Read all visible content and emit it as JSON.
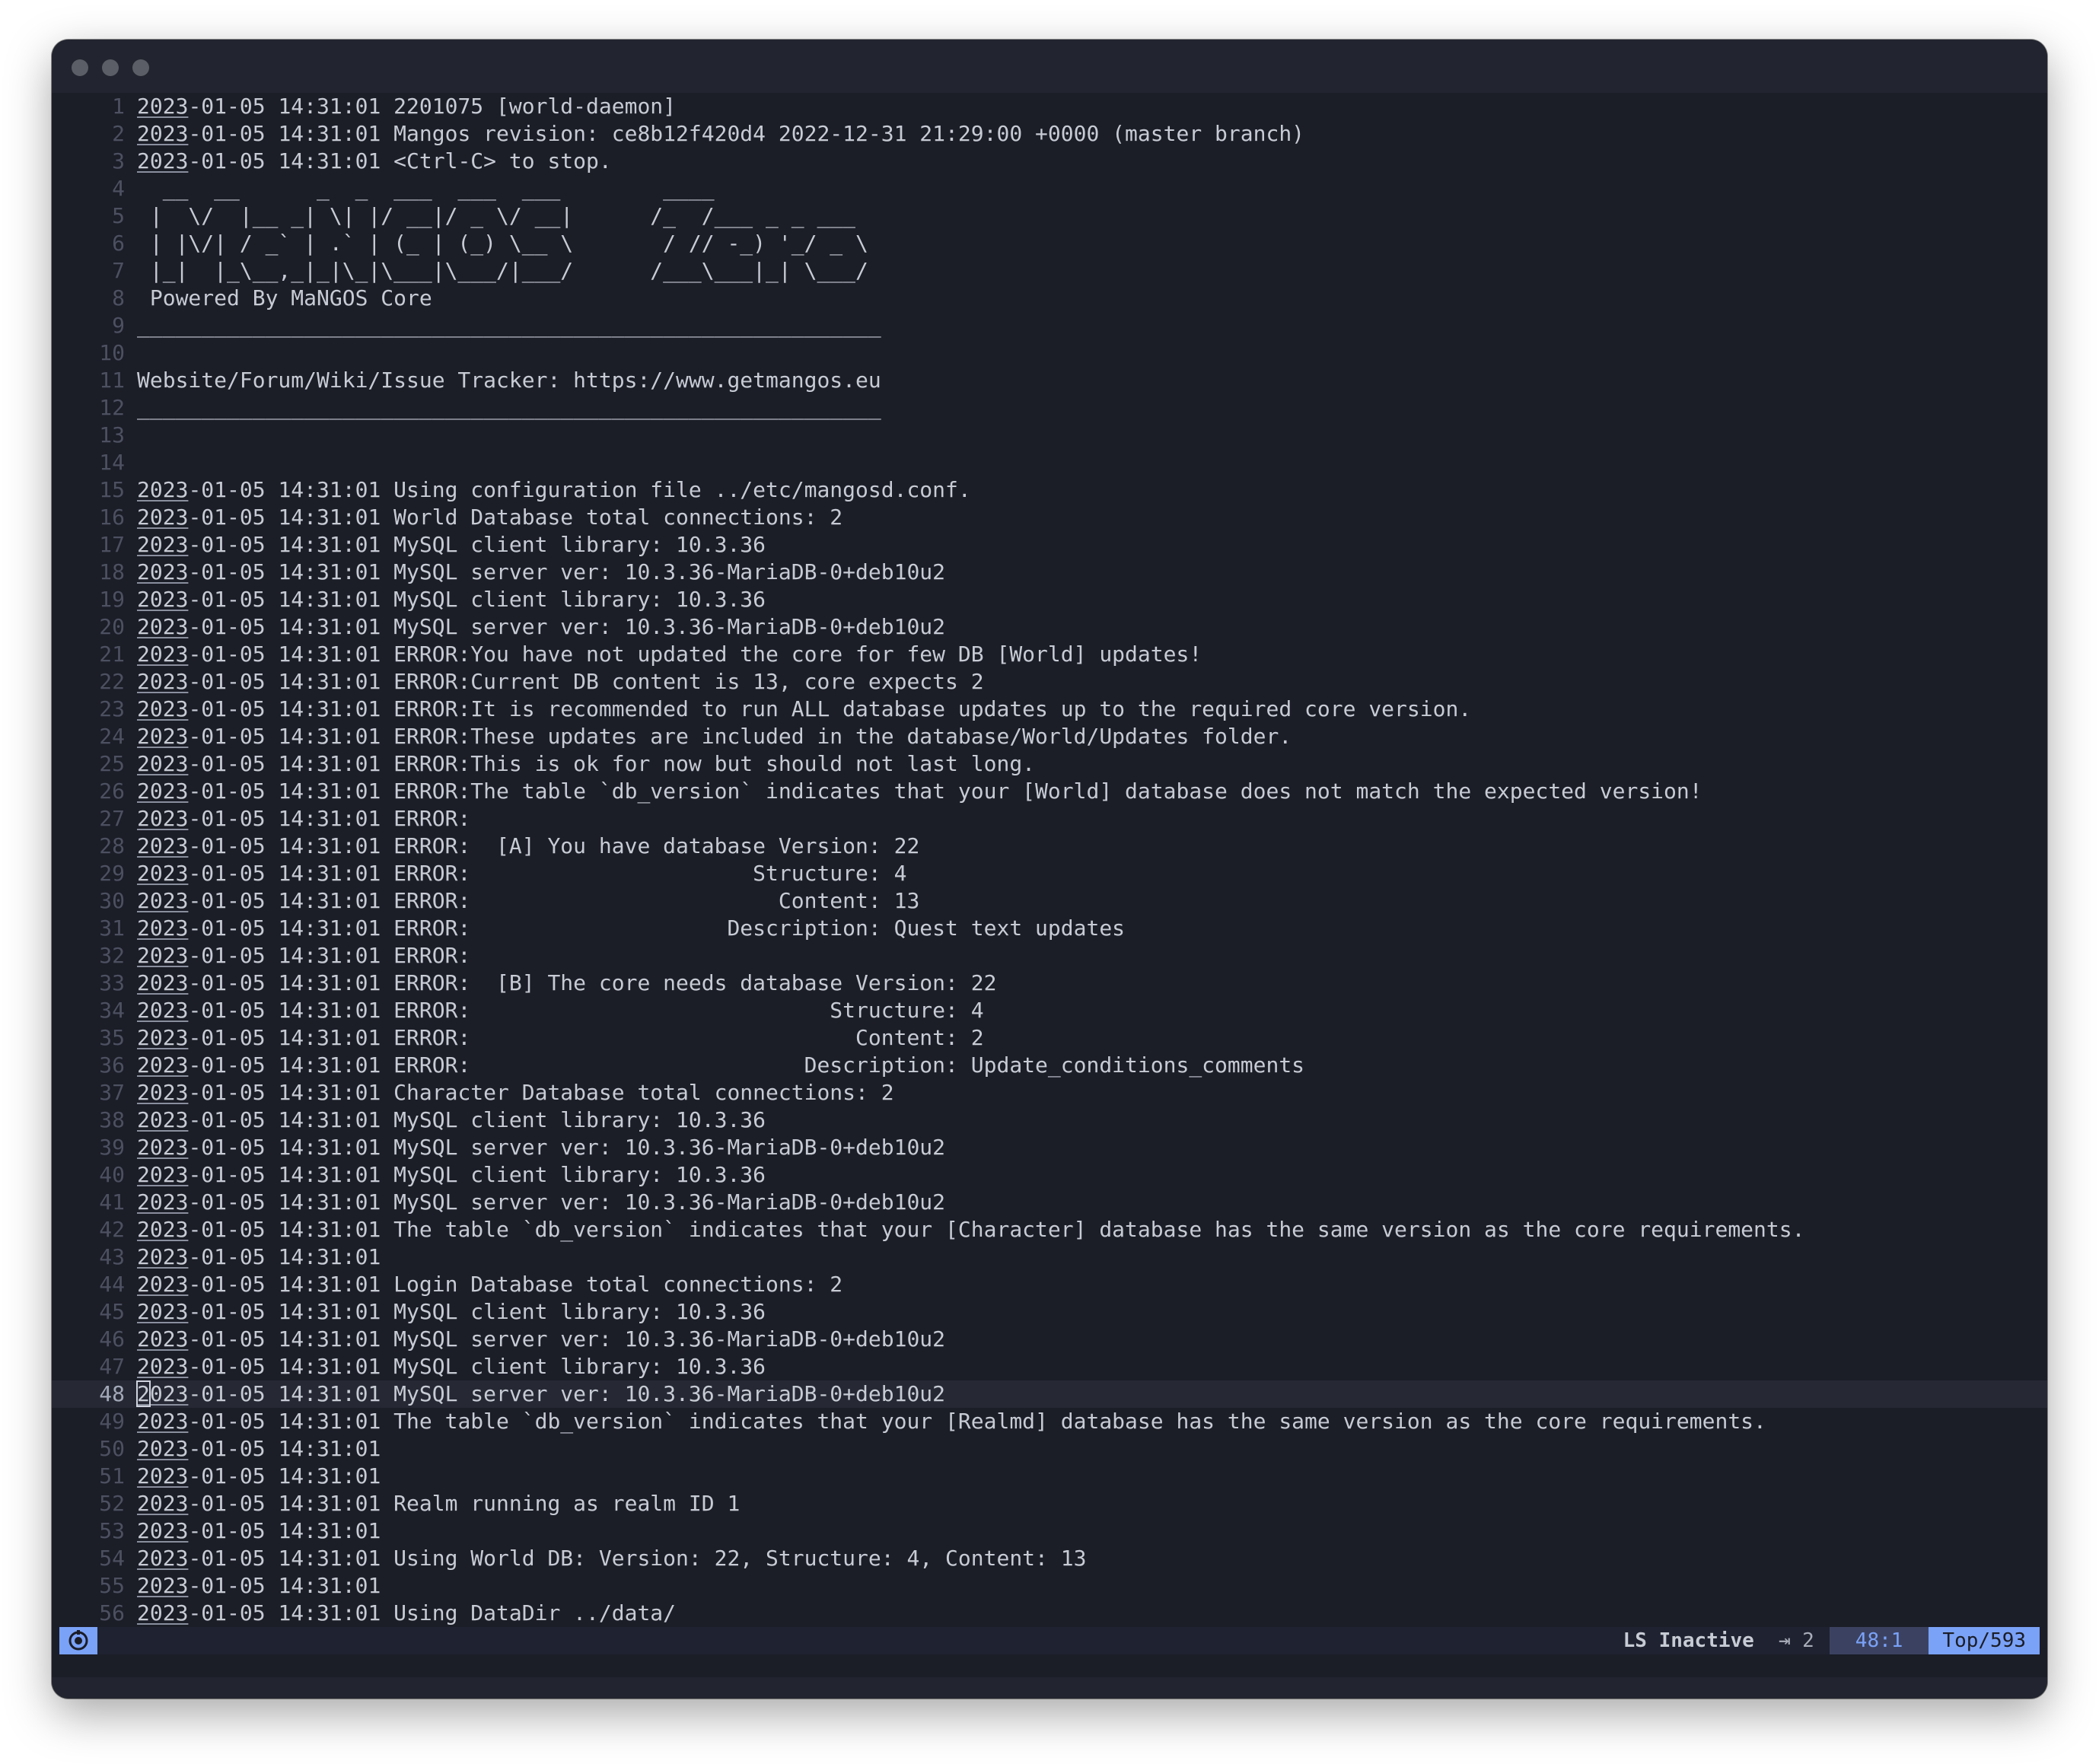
{
  "editor": {
    "lines": [
      "2023-01-05 14:31:01 2201075 [world-daemon]",
      "2023-01-05 14:31:01 Mangos revision: ce8b12f420d4 2022-12-31 21:29:00 +0000 (master branch)",
      "2023-01-05 14:31:01 <Ctrl-C> to stop.",
      "  __  __      _  _  ___  ___  ___        ____",
      " |  \\/  |__ _| \\| |/ __|/ _ \\/ __|      /_  /___ _ _ ___",
      " | |\\/| / _` | .` | (_ | (_) \\__ \\       / // -_) '_/ _ \\",
      " |_|  |_\\__,_|_|\\_|\\___|\\___/|___/      /___\\___|_| \\___/",
      " Powered By MaNGOS Core",
      "__________________________________________________________",
      "",
      "Website/Forum/Wiki/Issue Tracker: https://www.getmangos.eu",
      "__________________________________________________________",
      "",
      "",
      "2023-01-05 14:31:01 Using configuration file ../etc/mangosd.conf.",
      "2023-01-05 14:31:01 World Database total connections: 2",
      "2023-01-05 14:31:01 MySQL client library: 10.3.36",
      "2023-01-05 14:31:01 MySQL server ver: 10.3.36-MariaDB-0+deb10u2",
      "2023-01-05 14:31:01 MySQL client library: 10.3.36",
      "2023-01-05 14:31:01 MySQL server ver: 10.3.36-MariaDB-0+deb10u2",
      "2023-01-05 14:31:01 ERROR:You have not updated the core for few DB [World] updates!",
      "2023-01-05 14:31:01 ERROR:Current DB content is 13, core expects 2",
      "2023-01-05 14:31:01 ERROR:It is recommended to run ALL database updates up to the required core version.",
      "2023-01-05 14:31:01 ERROR:These updates are included in the database/World/Updates folder.",
      "2023-01-05 14:31:01 ERROR:This is ok for now but should not last long.",
      "2023-01-05 14:31:01 ERROR:The table `db_version` indicates that your [World] database does not match the expected version!",
      "2023-01-05 14:31:01 ERROR:",
      "2023-01-05 14:31:01 ERROR:  [A] You have database Version: 22",
      "2023-01-05 14:31:01 ERROR:                      Structure: 4",
      "2023-01-05 14:31:01 ERROR:                        Content: 13",
      "2023-01-05 14:31:01 ERROR:                    Description: Quest text updates",
      "2023-01-05 14:31:01 ERROR:",
      "2023-01-05 14:31:01 ERROR:  [B] The core needs database Version: 22",
      "2023-01-05 14:31:01 ERROR:                            Structure: 4",
      "2023-01-05 14:31:01 ERROR:                              Content: 2",
      "2023-01-05 14:31:01 ERROR:                          Description: Update_conditions_comments",
      "2023-01-05 14:31:01 Character Database total connections: 2",
      "2023-01-05 14:31:01 MySQL client library: 10.3.36",
      "2023-01-05 14:31:01 MySQL server ver: 10.3.36-MariaDB-0+deb10u2",
      "2023-01-05 14:31:01 MySQL client library: 10.3.36",
      "2023-01-05 14:31:01 MySQL server ver: 10.3.36-MariaDB-0+deb10u2",
      "2023-01-05 14:31:01 The table `db_version` indicates that your [Character] database has the same version as the core requirements.",
      "2023-01-05 14:31:01",
      "2023-01-05 14:31:01 Login Database total connections: 2",
      "2023-01-05 14:31:01 MySQL client library: 10.3.36",
      "2023-01-05 14:31:01 MySQL server ver: 10.3.36-MariaDB-0+deb10u2",
      "2023-01-05 14:31:01 MySQL client library: 10.3.36",
      "2023-01-05 14:31:01 MySQL server ver: 10.3.36-MariaDB-0+deb10u2",
      "2023-01-05 14:31:01 The table `db_version` indicates that your [Realmd] database has the same version as the core requirements.",
      "2023-01-05 14:31:01",
      "2023-01-05 14:31:01",
      "2023-01-05 14:31:01 Realm running as realm ID 1",
      "2023-01-05 14:31:01",
      "2023-01-05 14:31:01 Using World DB: Version: 22, Structure: 4, Content: 13",
      "2023-01-05 14:31:01",
      "2023-01-05 14:31:01 Using DataDir ../data/"
    ],
    "cursor_line": 48
  },
  "status": {
    "mode_icon": "vim-mode-icon",
    "ls_status": "LS Inactive",
    "indent_glyph": "⇥",
    "indent": "2",
    "position": "48:1",
    "scroll": "Top/593",
    "colors": {
      "accent": "#7aa2f7",
      "background": "#1b1d27",
      "text": "#c7cbd4"
    }
  }
}
